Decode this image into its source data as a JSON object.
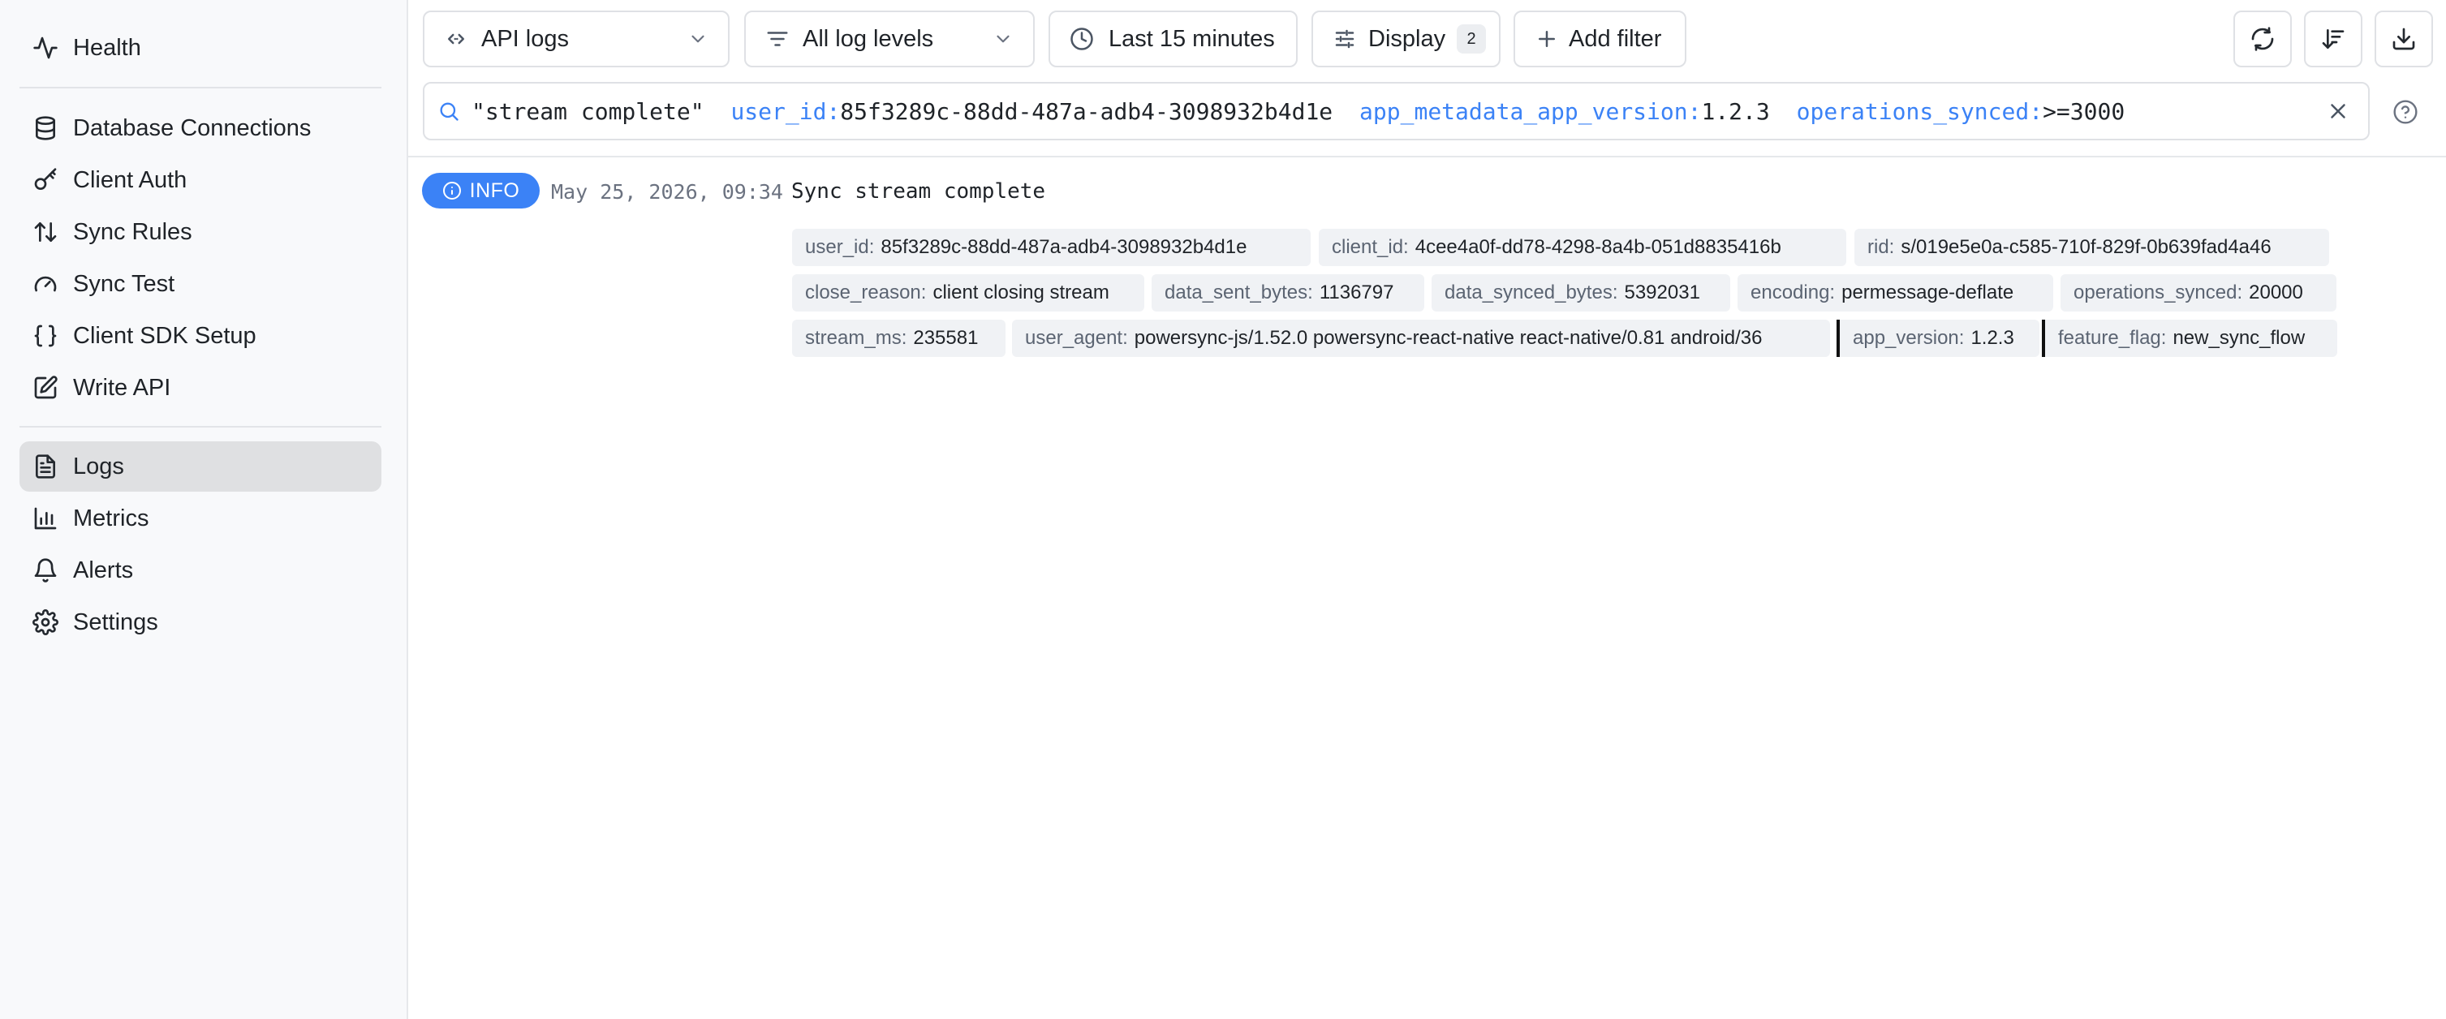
{
  "sidebar": {
    "items": [
      {
        "label": "Health",
        "icon": "activity-icon"
      },
      {
        "label": "Database Connections",
        "icon": "database-icon"
      },
      {
        "label": "Client Auth",
        "icon": "key-icon"
      },
      {
        "label": "Sync Rules",
        "icon": "arrows-up-down-icon"
      },
      {
        "label": "Sync Test",
        "icon": "gauge-icon"
      },
      {
        "label": "Client SDK Setup",
        "icon": "braces-icon"
      },
      {
        "label": "Write API",
        "icon": "edit-icon"
      },
      {
        "label": "Logs",
        "icon": "file-text-icon",
        "active": true
      },
      {
        "label": "Metrics",
        "icon": "bar-chart-icon"
      },
      {
        "label": "Alerts",
        "icon": "bell-icon"
      },
      {
        "label": "Settings",
        "icon": "gear-icon"
      }
    ]
  },
  "toolbar": {
    "log_source": "API logs",
    "log_level": "All log levels",
    "time_range": "Last 15 minutes",
    "display_label": "Display",
    "display_count": "2",
    "add_filter_label": "Add filter"
  },
  "search": {
    "phrase": "\"stream complete\"",
    "terms": [
      {
        "key": "user_id:",
        "value": "85f3289c-88dd-487a-adb4-3098932b4d1e"
      },
      {
        "key": "app_metadata_app_version:",
        "value": "1.2.3"
      },
      {
        "key": "operations_synced:",
        "value": ">=3000"
      }
    ]
  },
  "log": {
    "level": "INFO",
    "timestamp": "May 25, 2026, 09:34",
    "message": "Sync stream complete",
    "fields": [
      {
        "key": "user_id:",
        "value": "85f3289c-88dd-487a-adb4-3098932b4d1e"
      },
      {
        "key": "client_id:",
        "value": "4cee4a0f-dd78-4298-8a4b-051d8835416b"
      },
      {
        "key": "rid:",
        "value": "s/019e5e0a-c585-710f-829f-0b639fad4a46"
      },
      {
        "key": "close_reason:",
        "value": "client closing stream"
      },
      {
        "key": "data_sent_bytes:",
        "value": "1136797"
      },
      {
        "key": "data_synced_bytes:",
        "value": "5392031"
      },
      {
        "key": "encoding:",
        "value": "permessage-deflate"
      },
      {
        "key": "operations_synced:",
        "value": "20000"
      },
      {
        "key": "stream_ms:",
        "value": "235581"
      },
      {
        "key": "user_agent:",
        "value": "powersync-js/1.52.0 powersync-react-native react-native/0.81 android/36"
      },
      {
        "key": "app_version:",
        "value": "1.2.3"
      },
      {
        "key": "feature_flag:",
        "value": "new_sync_flow"
      }
    ]
  },
  "colors": {
    "accent": "#3b82f6",
    "active_nav": "#dfe0e2",
    "chip_bg": "#f0f2f5"
  }
}
